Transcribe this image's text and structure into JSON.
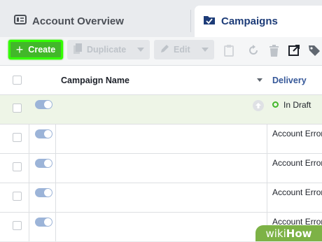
{
  "tabs": {
    "account_overview": "Account Overview",
    "campaigns": "Campaigns"
  },
  "toolbar": {
    "create_label": "Create",
    "duplicate_label": "Duplicate",
    "edit_label": "Edit"
  },
  "table": {
    "columns": {
      "name": "Campaign Name",
      "delivery": "Delivery"
    },
    "rows": [
      {
        "delivery": "In Draft"
      },
      {
        "delivery": "Account Error"
      },
      {
        "delivery": "Account Error"
      },
      {
        "delivery": "Account Error"
      },
      {
        "delivery": "Account Error"
      }
    ]
  },
  "watermark": {
    "prefix": "wiki",
    "suffix": "How"
  },
  "colors": {
    "create_green": "#42b72a",
    "highlight": "#33ff00",
    "link_blue": "#365899",
    "tab_blue": "#1d3c78",
    "toggle_blue": "#9cb4d8"
  },
  "icons": [
    "document-icon",
    "folder-check-icon",
    "copy-icon",
    "pencil-icon",
    "clipboard-icon",
    "refresh-icon",
    "trash-icon",
    "export-icon",
    "tag-icon",
    "arrow-up-icon"
  ]
}
